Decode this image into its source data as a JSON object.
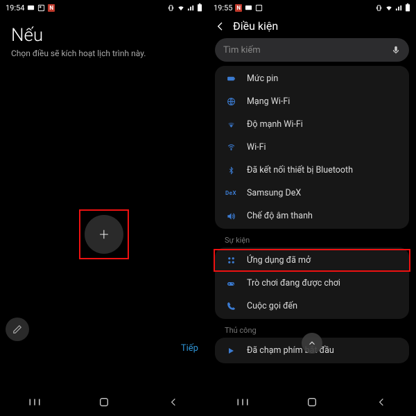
{
  "left": {
    "statusbar": {
      "time": "19:54"
    },
    "title": "Nếu",
    "subtitle": "Chọn điều sẽ kích hoạt lịch trình này.",
    "next_label": "Tiếp"
  },
  "right": {
    "statusbar": {
      "time": "19:55"
    },
    "header_title": "Điều kiện",
    "search_placeholder": "Tìm kiếm",
    "sections": {
      "status": {
        "items": [
          {
            "icon": "battery",
            "label": "Mức pin"
          },
          {
            "icon": "wifi-net",
            "label": "Mạng Wi-Fi"
          },
          {
            "icon": "wifi-strength",
            "label": "Độ mạnh Wi-Fi"
          },
          {
            "icon": "wifi",
            "label": "Wi-Fi"
          },
          {
            "icon": "bluetooth",
            "label": "Đã kết nối thiết bị Bluetooth"
          },
          {
            "icon": "dex",
            "label": "Samsung DeX"
          },
          {
            "icon": "sound",
            "label": "Chế độ âm thanh"
          }
        ]
      },
      "event": {
        "label": "Sự kiện",
        "items": [
          {
            "icon": "apps",
            "label": "Ứng dụng đã mở"
          },
          {
            "icon": "game",
            "label": "Trò chơi đang được chơi"
          },
          {
            "icon": "call",
            "label": "Cuộc gọi đến"
          }
        ]
      },
      "manual": {
        "label": "Thủ công",
        "items": [
          {
            "icon": "play",
            "label": "Đã chạm phím bắt đầu"
          }
        ]
      }
    }
  }
}
